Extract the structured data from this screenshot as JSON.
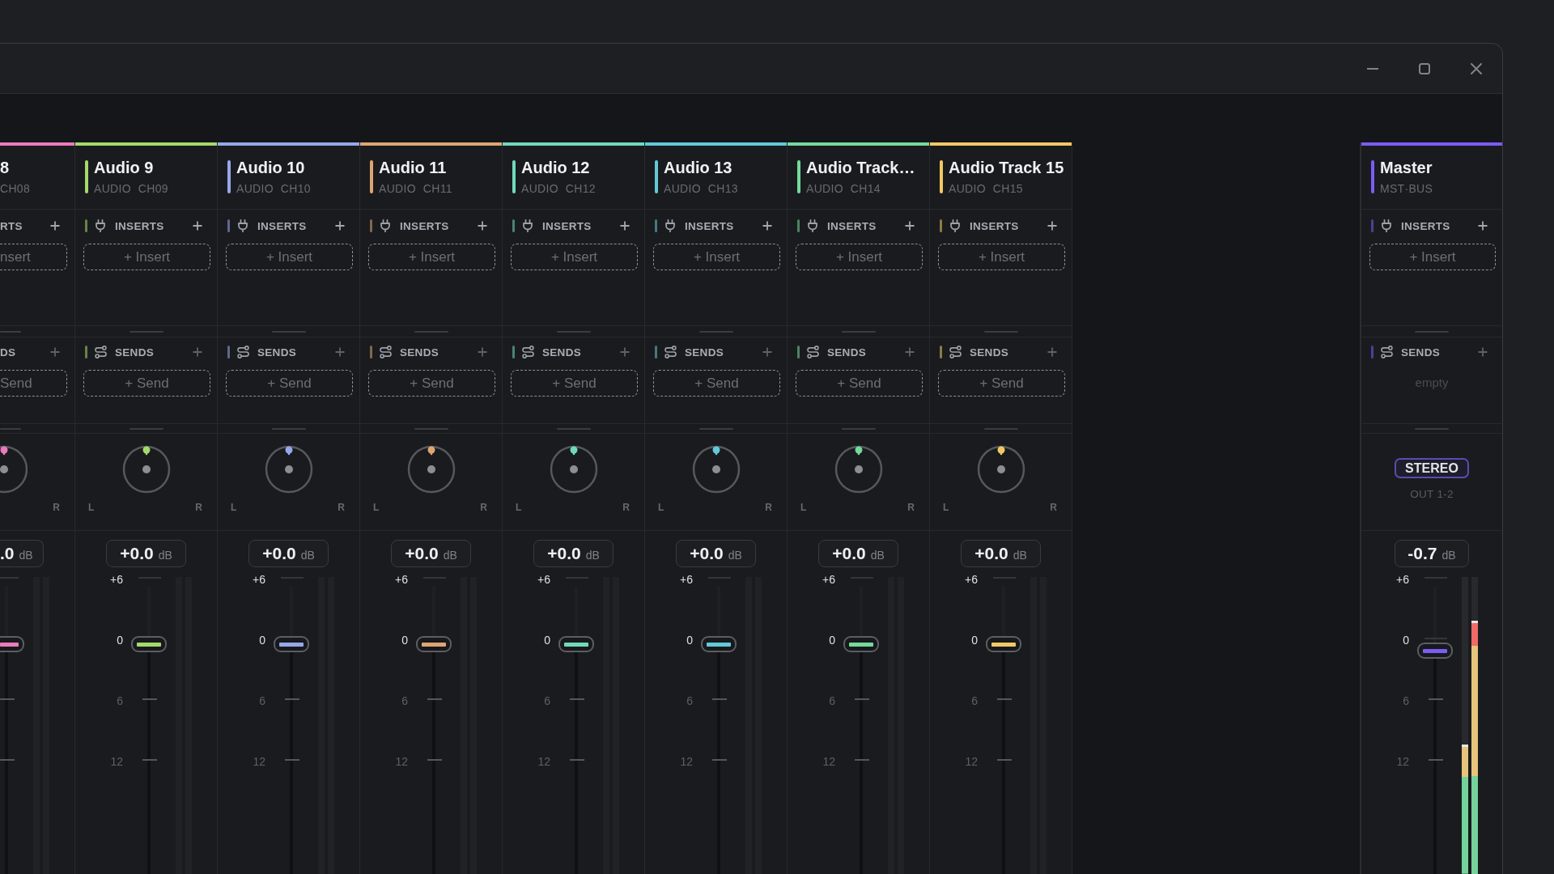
{
  "channels": [
    {
      "kind": "partial",
      "name": "8",
      "code": "CH08",
      "color": "#e97bbd",
      "inserts": {
        "label": "RTS",
        "button": "nsert",
        "add_disabled": false
      },
      "sends": {
        "label": "DS",
        "button": "Send",
        "add_disabled": true
      },
      "pan": {
        "right": "R"
      },
      "fader": {
        "value": ".0",
        "unit": "dB",
        "level": 0.8,
        "scale": [
          {
            "kind": "major"
          },
          {
            "kind": "major"
          },
          {
            "kind": "minor"
          },
          {
            "kind": "minor"
          }
        ]
      }
    },
    {
      "kind": "audio",
      "name": "Audio 9",
      "category": "AUDIO",
      "code": "CH09",
      "color": "#a5d96c",
      "inserts": {
        "label": "INSERTS",
        "button": "+ Insert",
        "add_disabled": false
      },
      "sends": {
        "label": "SENDS",
        "button": "+ Send",
        "add_disabled": true
      },
      "pan": {
        "level": 0.5,
        "left": "L",
        "right": "R"
      },
      "fader": {
        "value": "+0.0",
        "unit": "dB",
        "level": 0.8,
        "scale": [
          {
            "label": "+6",
            "kind": "major"
          },
          {
            "label": "0",
            "kind": "major"
          },
          {
            "label": "6",
            "kind": "minor"
          },
          {
            "label": "12",
            "kind": "minor"
          }
        ]
      }
    },
    {
      "kind": "audio",
      "name": "Audio 10",
      "category": "AUDIO",
      "code": "CH10",
      "color": "#98a7eb",
      "inserts": {
        "label": "INSERTS",
        "button": "+ Insert",
        "add_disabled": false
      },
      "sends": {
        "label": "SENDS",
        "button": "+ Send",
        "add_disabled": true
      },
      "pan": {
        "level": 0.5,
        "left": "L",
        "right": "R"
      },
      "fader": {
        "value": "+0.0",
        "unit": "dB",
        "level": 0.8,
        "scale": [
          {
            "label": "+6",
            "kind": "major"
          },
          {
            "label": "0",
            "kind": "major"
          },
          {
            "label": "6",
            "kind": "minor"
          },
          {
            "label": "12",
            "kind": "minor"
          }
        ]
      }
    },
    {
      "kind": "audio",
      "name": "Audio 11",
      "category": "AUDIO",
      "code": "CH11",
      "color": "#dea573",
      "inserts": {
        "label": "INSERTS",
        "button": "+ Insert",
        "add_disabled": false
      },
      "sends": {
        "label": "SENDS",
        "button": "+ Send",
        "add_disabled": true
      },
      "pan": {
        "level": 0.5,
        "left": "L",
        "right": "R"
      },
      "fader": {
        "value": "+0.0",
        "unit": "dB",
        "level": 0.8,
        "scale": [
          {
            "label": "+6",
            "kind": "major"
          },
          {
            "label": "0",
            "kind": "major"
          },
          {
            "label": "6",
            "kind": "minor"
          },
          {
            "label": "12",
            "kind": "minor"
          }
        ]
      }
    },
    {
      "kind": "audio",
      "name": "Audio 12",
      "category": "AUDIO",
      "code": "CH12",
      "color": "#72d8be",
      "inserts": {
        "label": "INSERTS",
        "button": "+ Insert",
        "add_disabled": false
      },
      "sends": {
        "label": "SENDS",
        "button": "+ Send",
        "add_disabled": true
      },
      "pan": {
        "level": 0.5,
        "left": "L",
        "right": "R"
      },
      "fader": {
        "value": "+0.0",
        "unit": "dB",
        "level": 0.8,
        "scale": [
          {
            "label": "+6",
            "kind": "major"
          },
          {
            "label": "0",
            "kind": "major"
          },
          {
            "label": "6",
            "kind": "minor"
          },
          {
            "label": "12",
            "kind": "minor"
          }
        ]
      }
    },
    {
      "kind": "audio",
      "name": "Audio 13",
      "category": "AUDIO",
      "code": "CH13",
      "color": "#62c9d8",
      "inserts": {
        "label": "INSERTS",
        "button": "+ Insert",
        "add_disabled": false
      },
      "sends": {
        "label": "SENDS",
        "button": "+ Send",
        "add_disabled": true
      },
      "pan": {
        "level": 0.5,
        "left": "L",
        "right": "R"
      },
      "fader": {
        "value": "+0.0",
        "unit": "dB",
        "level": 0.8,
        "scale": [
          {
            "label": "+6",
            "kind": "major"
          },
          {
            "label": "0",
            "kind": "major"
          },
          {
            "label": "6",
            "kind": "minor"
          },
          {
            "label": "12",
            "kind": "minor"
          }
        ]
      }
    },
    {
      "kind": "audio",
      "name": "Audio Track…",
      "category": "AUDIO",
      "code": "CH14",
      "color": "#74d99c",
      "inserts": {
        "label": "INSERTS",
        "button": "+ Insert",
        "add_disabled": false
      },
      "sends": {
        "label": "SENDS",
        "button": "+ Send",
        "add_disabled": true
      },
      "pan": {
        "level": 0.5,
        "left": "L",
        "right": "R"
      },
      "fader": {
        "value": "+0.0",
        "unit": "dB",
        "level": 0.8,
        "scale": [
          {
            "label": "+6",
            "kind": "major"
          },
          {
            "label": "0",
            "kind": "major"
          },
          {
            "label": "6",
            "kind": "minor"
          },
          {
            "label": "12",
            "kind": "minor"
          }
        ]
      }
    },
    {
      "kind": "audio",
      "name": "Audio Track 15",
      "category": "AUDIO",
      "code": "CH15",
      "color": "#f1c964",
      "inserts": {
        "label": "INSERTS",
        "button": "+ Insert",
        "add_disabled": false
      },
      "sends": {
        "label": "SENDS",
        "button": "+ Send",
        "add_disabled": true
      },
      "pan": {
        "level": 0.5,
        "left": "L",
        "right": "R"
      },
      "fader": {
        "value": "+0.0",
        "unit": "dB",
        "level": 0.8,
        "scale": [
          {
            "label": "+6",
            "kind": "major"
          },
          {
            "label": "0",
            "kind": "major"
          },
          {
            "label": "6",
            "kind": "minor"
          },
          {
            "label": "12",
            "kind": "minor"
          }
        ]
      }
    },
    {
      "kind": "master",
      "name": "Master",
      "code": "MST·BUS",
      "color": "#7c5cf6",
      "inserts": {
        "label": "INSERTS",
        "button": "+ Insert",
        "add_disabled": false
      },
      "sends": {
        "label": "SENDS",
        "note": "empty",
        "add_disabled": true
      },
      "output": {
        "badge": "STEREO",
        "route": "OUT 1-2"
      },
      "fader": {
        "value": "-0.7",
        "unit": "dB",
        "level": 0.777,
        "scale": [
          {
            "label": "+6",
            "kind": "major"
          },
          {
            "label": "0",
            "kind": "major"
          },
          {
            "label": "6",
            "kind": "minor"
          },
          {
            "label": "12",
            "kind": "minor"
          }
        ]
      },
      "meters": [
        {
          "level": 0.435
        },
        {
          "level": 0.853
        }
      ]
    }
  ]
}
